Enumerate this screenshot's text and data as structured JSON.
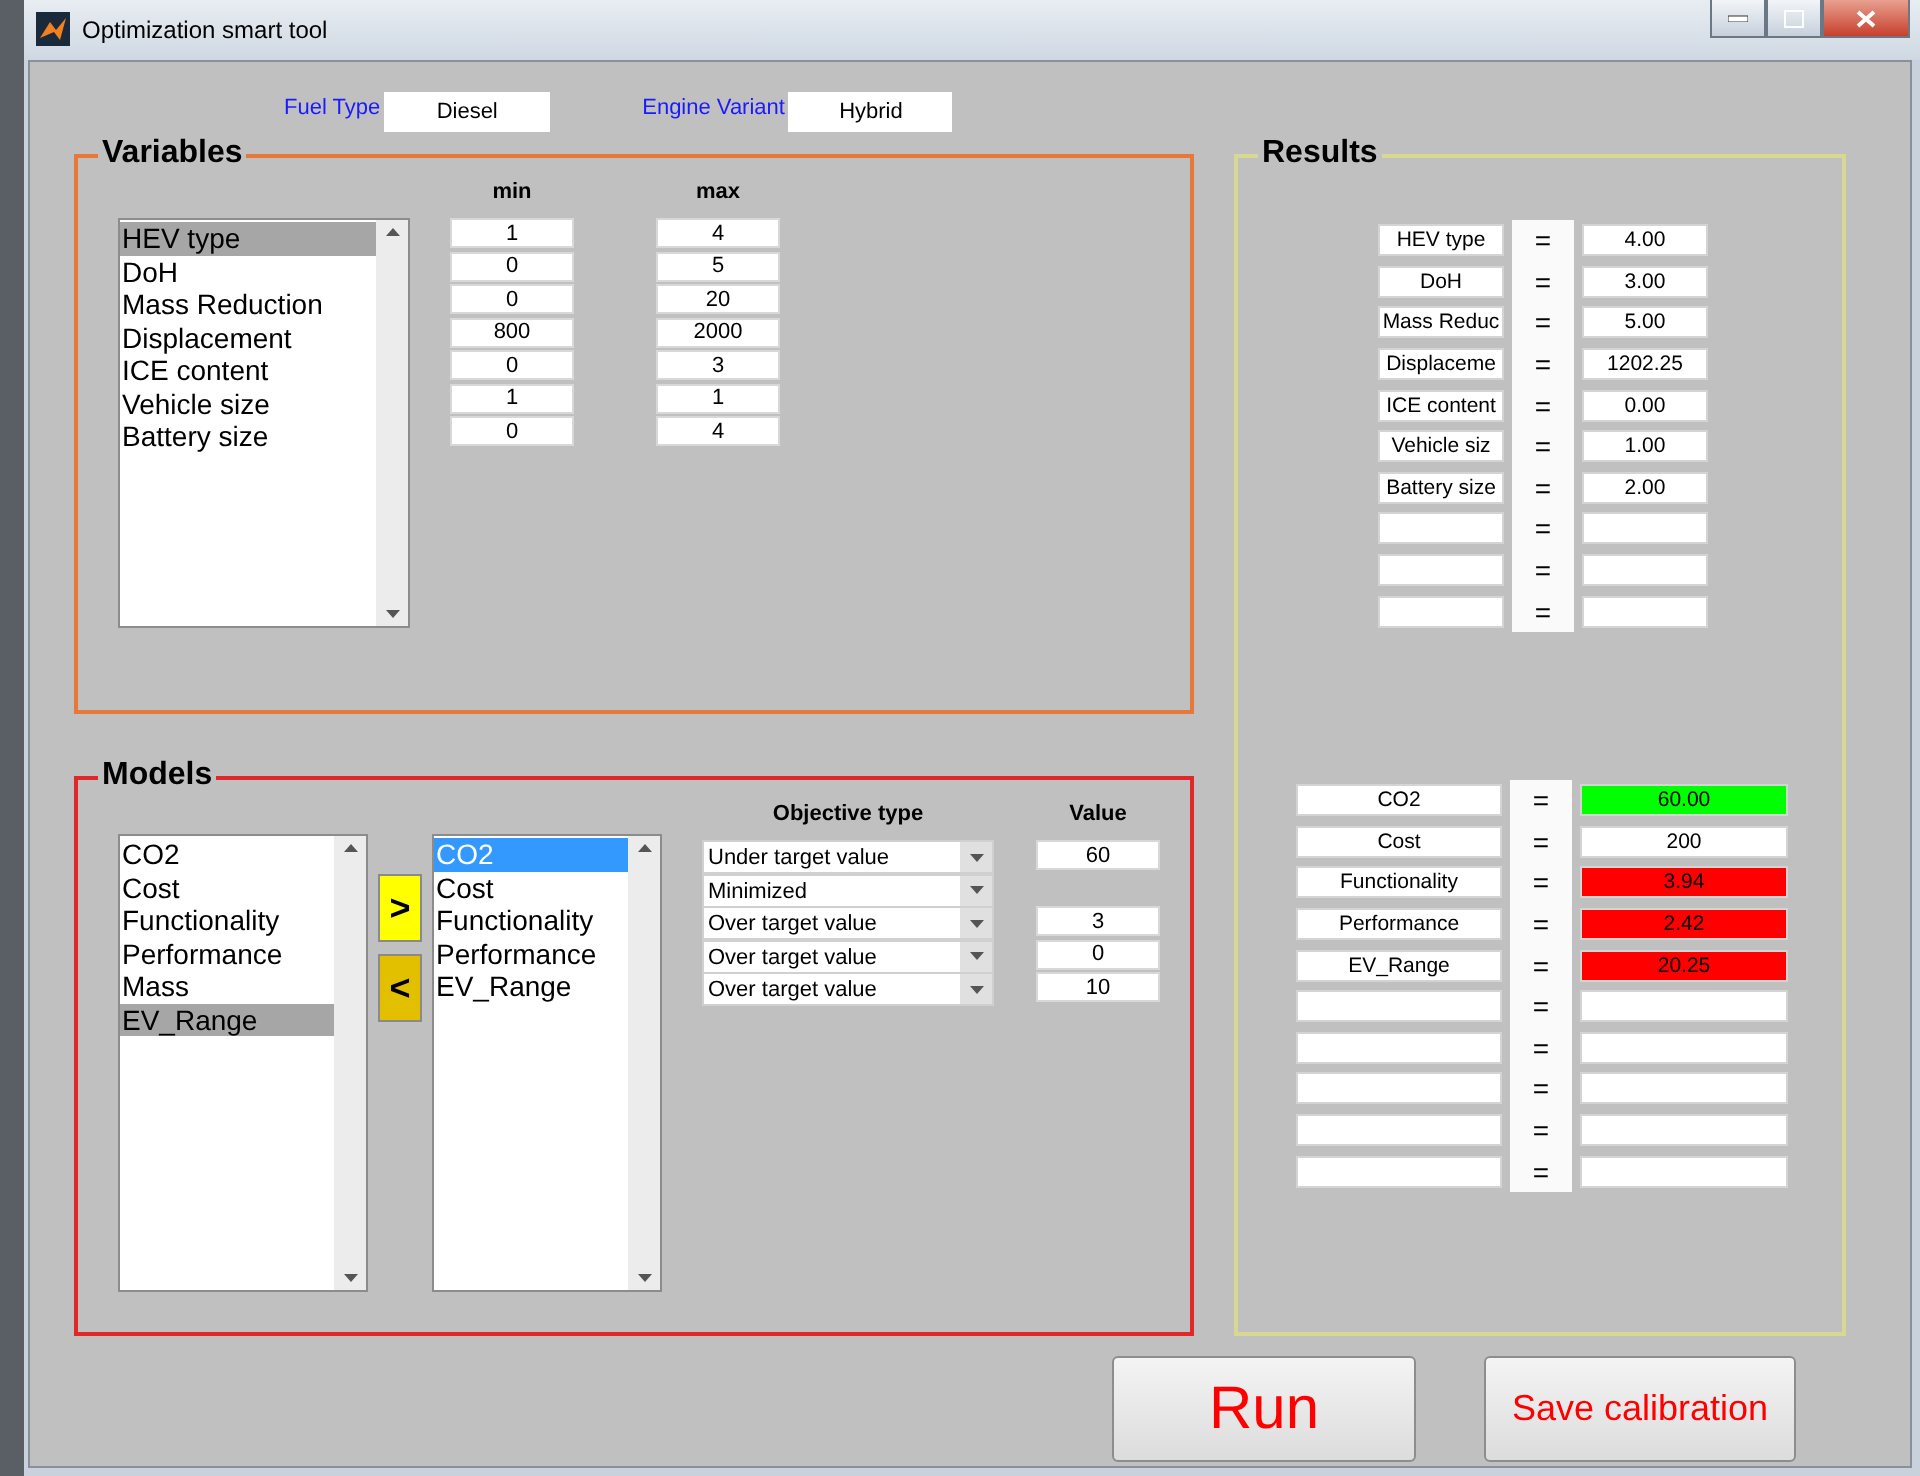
{
  "window": {
    "title": "Optimization smart tool"
  },
  "fuel_type": {
    "label": "Fuel Type",
    "value": "Diesel"
  },
  "engine_variant": {
    "label": "Engine Variant",
    "value": "Hybrid"
  },
  "variables": {
    "title": "Variables",
    "min_header": "min",
    "max_header": "max",
    "list": {
      "focused": false,
      "items": [
        {
          "label": "HEV type",
          "selected": true
        },
        {
          "label": "DoH",
          "selected": false
        },
        {
          "label": "Mass Reduction",
          "selected": false
        },
        {
          "label": "Displacement",
          "selected": false
        },
        {
          "label": "ICE content",
          "selected": false
        },
        {
          "label": "Vehicle size",
          "selected": false
        },
        {
          "label": "Battery size",
          "selected": false
        }
      ]
    },
    "ranges": [
      {
        "min": "1",
        "max": "4"
      },
      {
        "min": "0",
        "max": "5"
      },
      {
        "min": "0",
        "max": "20"
      },
      {
        "min": "800",
        "max": "2000"
      },
      {
        "min": "0",
        "max": "3"
      },
      {
        "min": "1",
        "max": "1"
      },
      {
        "min": "0",
        "max": "4"
      }
    ]
  },
  "models": {
    "title": "Models",
    "add_button": ">",
    "remove_button": "<",
    "objective_header": "Objective type",
    "value_header": "Value",
    "available": {
      "focused": false,
      "items": [
        {
          "label": "CO2",
          "selected": false
        },
        {
          "label": "Cost",
          "selected": false
        },
        {
          "label": "Functionality",
          "selected": false
        },
        {
          "label": "Performance",
          "selected": false
        },
        {
          "label": "Mass",
          "selected": false
        },
        {
          "label": "EV_Range",
          "selected": true
        }
      ]
    },
    "chosen": {
      "focused": true,
      "items": [
        {
          "label": "CO2",
          "selected": true
        },
        {
          "label": "Cost",
          "selected": false
        },
        {
          "label": "Functionality",
          "selected": false
        },
        {
          "label": "Performance",
          "selected": false
        },
        {
          "label": "EV_Range",
          "selected": false
        }
      ]
    },
    "objectives": [
      {
        "type": "Under target value",
        "value": "60"
      },
      {
        "type": "Minimized"
      },
      {
        "type": "Over target value",
        "value": "3"
      },
      {
        "type": "Over target value",
        "value": "0"
      },
      {
        "type": "Over target value",
        "value": "10"
      }
    ]
  },
  "results": {
    "title": "Results",
    "variable_rows": [
      {
        "kind": "filled",
        "name": "HEV type",
        "equals": "=",
        "value": "4.00"
      },
      {
        "kind": "filled",
        "name": "DoH",
        "equals": "=",
        "value": "3.00"
      },
      {
        "kind": "filled",
        "name": "Mass Reduc",
        "equals": "=",
        "value": "5.00"
      },
      {
        "kind": "filled",
        "name": "Displaceme",
        "equals": "=",
        "value": "1202.25"
      },
      {
        "kind": "filled",
        "name": "ICE content",
        "equals": "=",
        "value": "0.00"
      },
      {
        "kind": "filled",
        "name": "Vehicle siz",
        "equals": "=",
        "value": "1.00"
      },
      {
        "kind": "filled",
        "name": "Battery size",
        "equals": "=",
        "value": "2.00"
      },
      {
        "kind": "empty",
        "equals": "="
      },
      {
        "kind": "empty",
        "equals": "="
      },
      {
        "kind": "empty",
        "equals": "="
      }
    ],
    "model_rows": [
      {
        "kind": "filled",
        "name": "CO2",
        "equals": "=",
        "value": "60.00",
        "color": "#00ff00"
      },
      {
        "kind": "filled",
        "name": "Cost",
        "equals": "=",
        "value": "200",
        "color": "#ffffff"
      },
      {
        "kind": "filled",
        "name": "Functionality",
        "equals": "=",
        "value": "3.94",
        "color": "#ff0000"
      },
      {
        "kind": "filled",
        "name": "Performance",
        "equals": "=",
        "value": "2.42",
        "color": "#ff0000"
      },
      {
        "kind": "filled",
        "name": "EV_Range",
        "equals": "=",
        "value": "20.25",
        "color": "#ff0000"
      },
      {
        "kind": "empty",
        "equals": "="
      },
      {
        "kind": "empty",
        "equals": "="
      },
      {
        "kind": "empty",
        "equals": "="
      },
      {
        "kind": "empty",
        "equals": "="
      },
      {
        "kind": "empty",
        "equals": "="
      }
    ]
  },
  "buttons": {
    "run": "Run",
    "save": "Save calibration"
  }
}
